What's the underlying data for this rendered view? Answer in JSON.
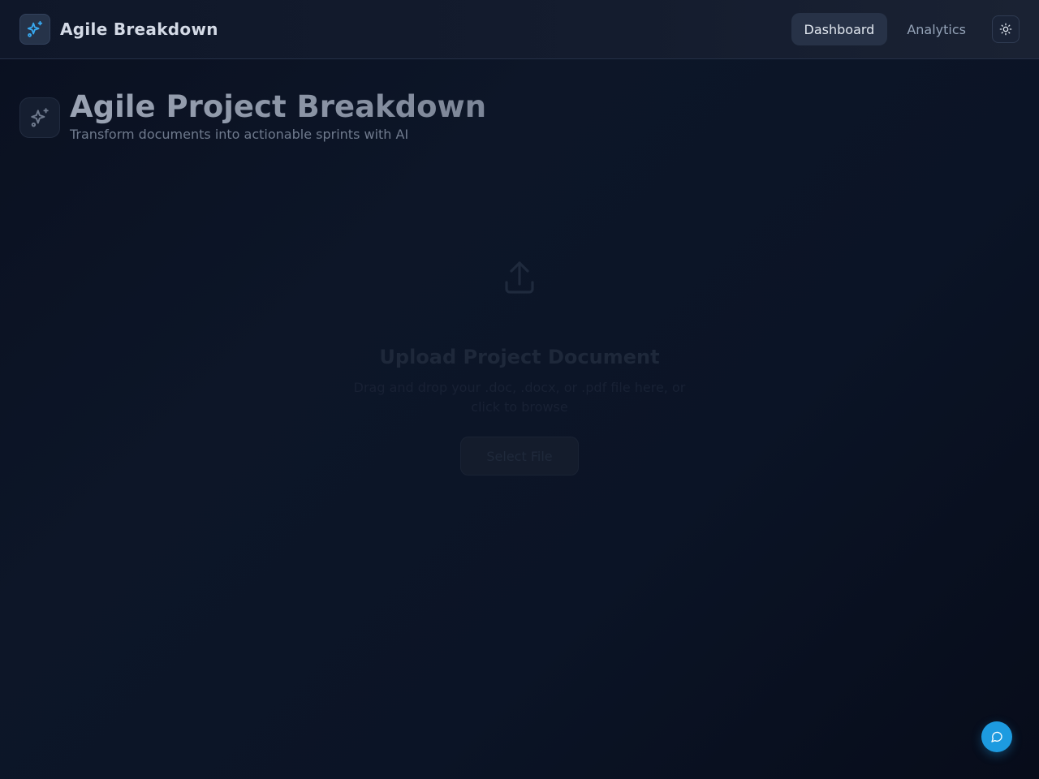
{
  "header": {
    "brand_title": "Agile Breakdown",
    "nav": [
      {
        "label": "Dashboard",
        "active": true
      },
      {
        "label": "Analytics",
        "active": false
      }
    ],
    "theme_icon": "sun-icon",
    "brand_icon": "sparkles-icon"
  },
  "hero": {
    "title": "Agile Project Breakdown",
    "subtitle": "Transform documents into actionable sprints with AI",
    "icon": "sparkles-icon"
  },
  "upload": {
    "icon": "upload-icon",
    "title": "Upload Project Document",
    "description": "Drag and drop your .doc, .docx, or .pdf file here, or click to browse",
    "button_label": "Select File"
  },
  "chat": {
    "icon": "chat-bubble-icon"
  },
  "colors": {
    "accent": "#1d9be0",
    "brand_icon": "#38a9f0",
    "background": "#0b1426"
  }
}
